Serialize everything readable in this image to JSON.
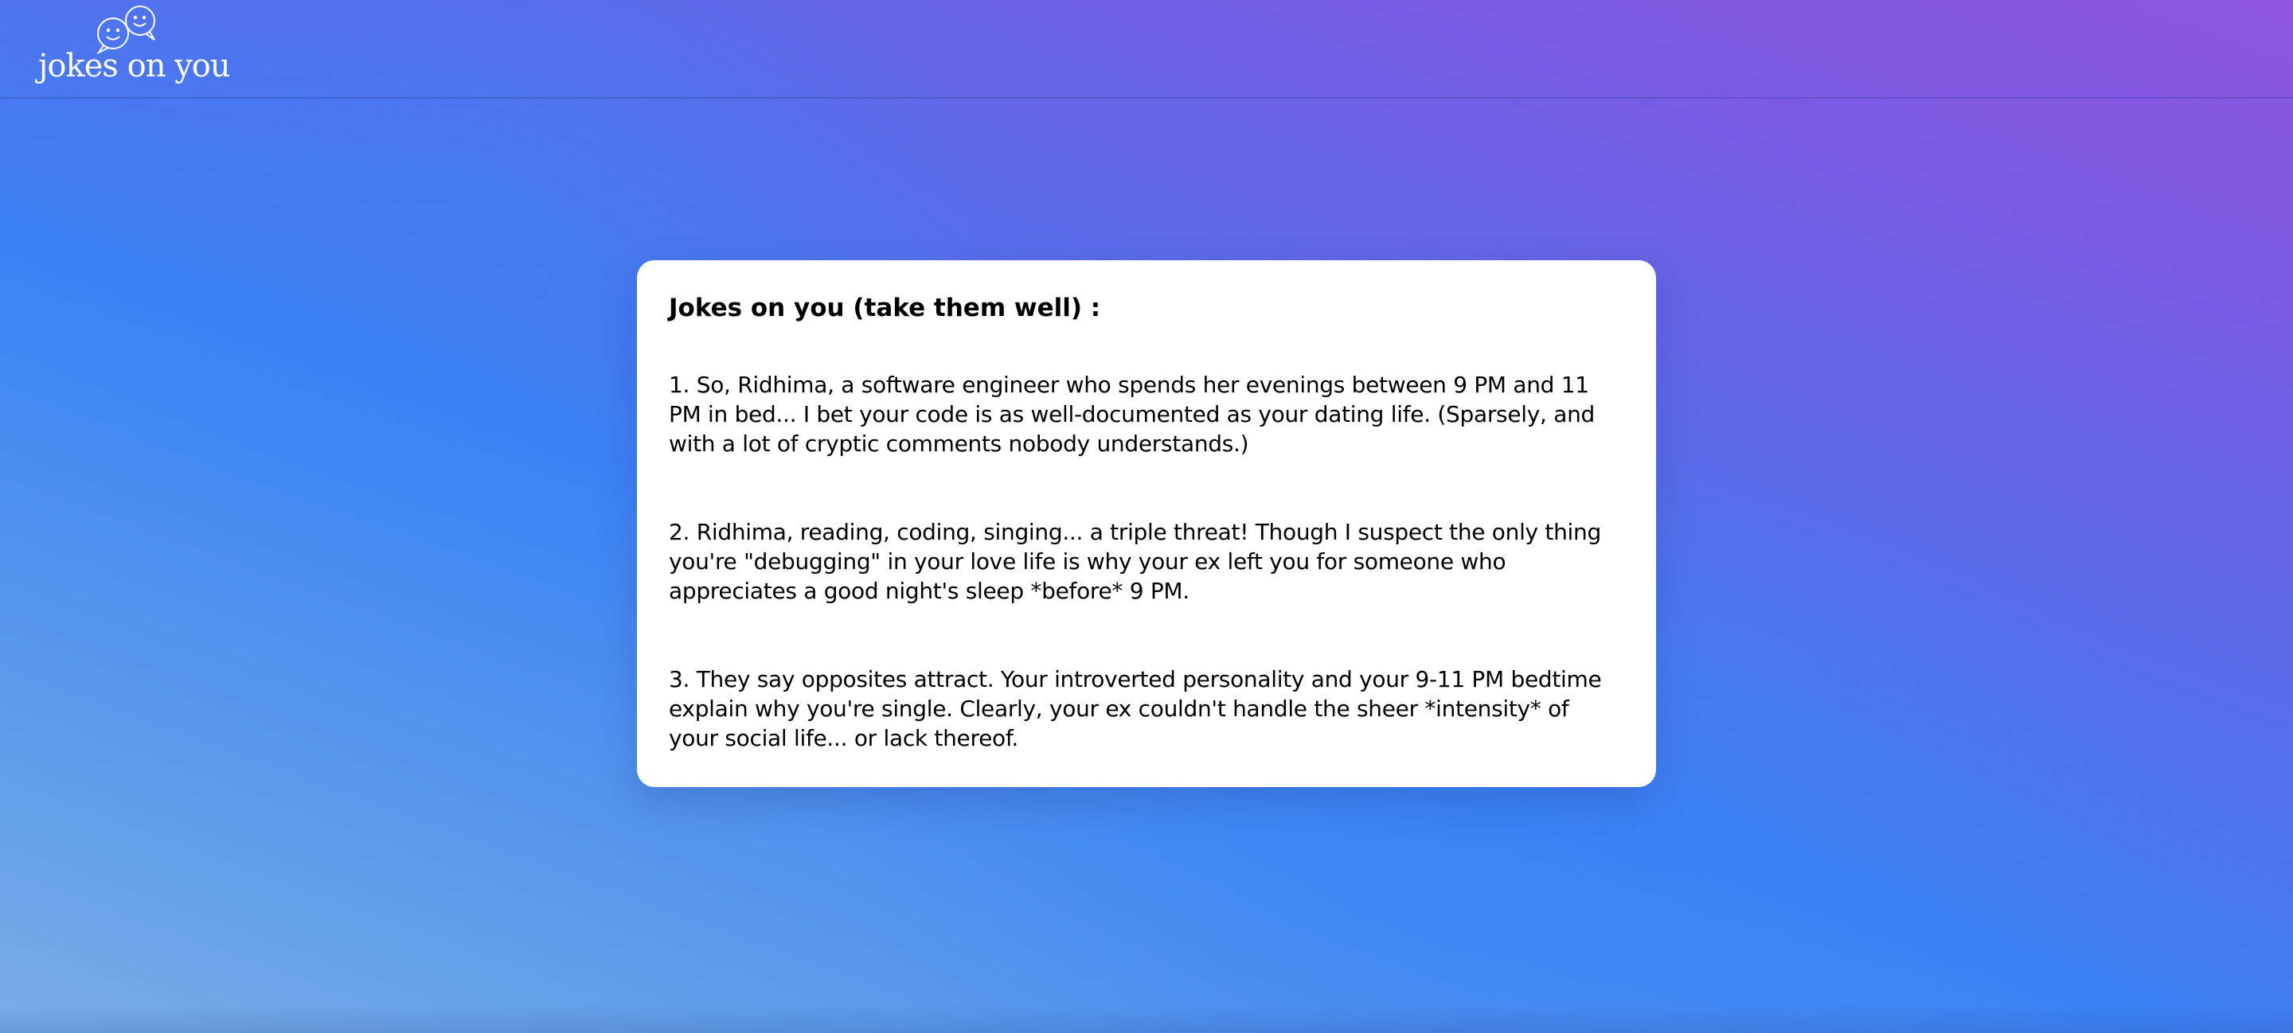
{
  "header": {
    "logo_text": "jokes on you",
    "logo_icon": "speech-bubbles-smiley-icon"
  },
  "card": {
    "title": "Jokes on you (take them well) :",
    "jokes": [
      "1. So, Ridhima, a software engineer who spends her evenings between 9 PM and 11 PM in bed... I bet your code is as well-documented as your dating life. (Sparsely, and with a lot of cryptic comments nobody understands.)",
      "2. Ridhima, reading, coding, singing... a triple threat! Though I suspect the only thing you're \"debugging\" in your love life is why your ex left you for someone who appreciates a good night's sleep *before* 9 PM.",
      "3. They say opposites attract. Your introverted personality and your 9-11 PM bedtime explain why you're single. Clearly, your ex couldn't handle the sheer *intensity* of your social life... or lack thereof."
    ]
  },
  "colors": {
    "background_start": "#7aaee6",
    "background_mid": "#3b82f6",
    "background_end": "#8f55e0",
    "card_background": "#ffffff",
    "text": "#000000"
  }
}
